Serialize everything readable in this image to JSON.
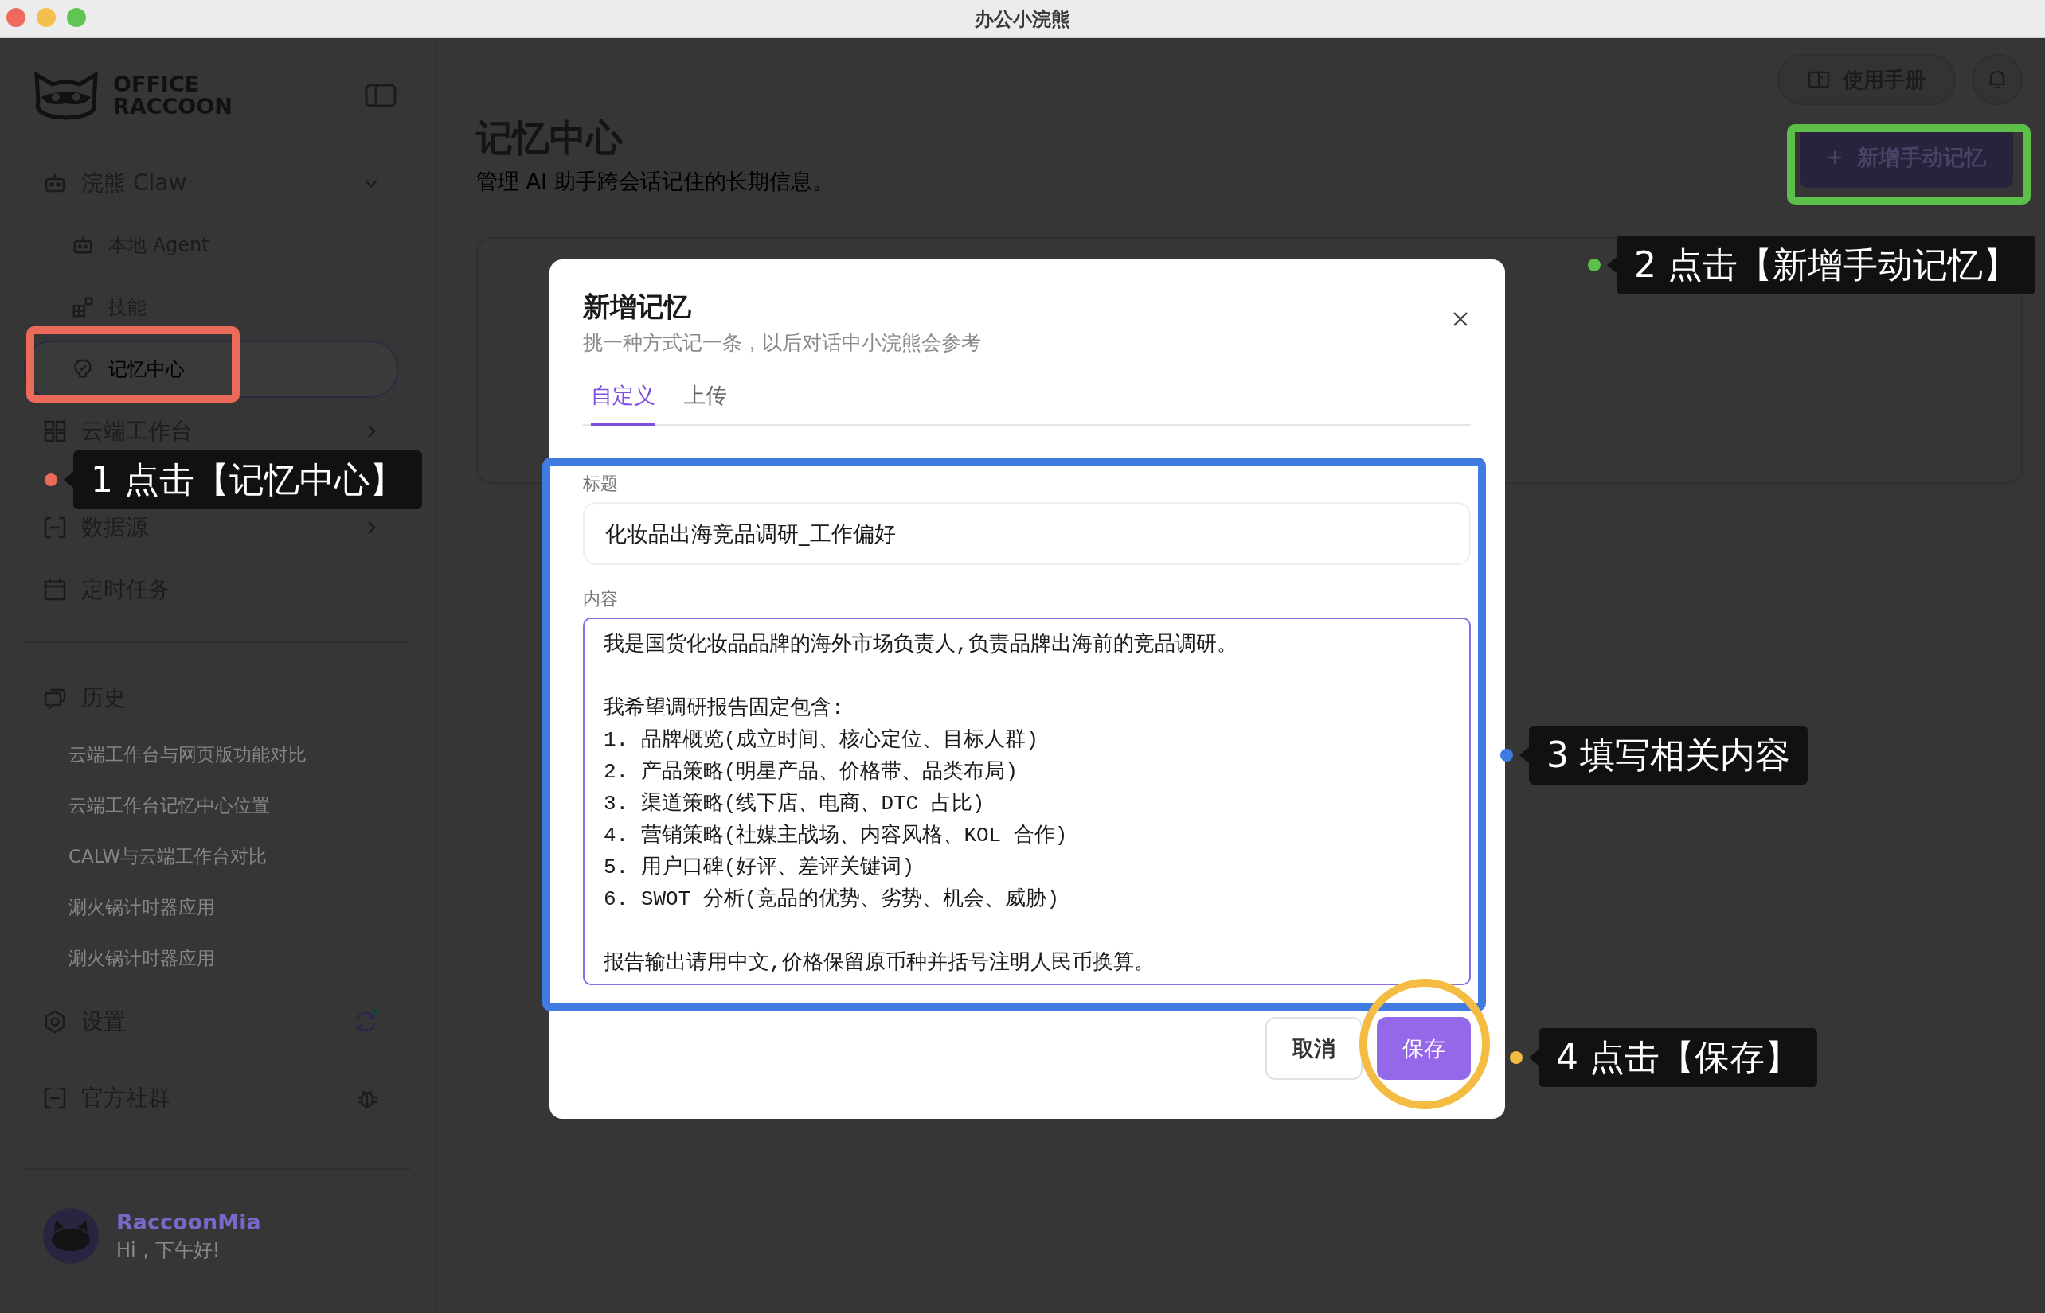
{
  "window": {
    "title": "办公小浣熊"
  },
  "sidebar": {
    "logo": {
      "line_1": "OFFICE",
      "line_2": "RACCOON"
    },
    "nav": [
      {
        "label": "浣熊 Claw",
        "kind": "group",
        "expanded": true,
        "selected": false,
        "children": [
          {
            "label": "本地 Agent",
            "selected": false
          },
          {
            "label": "技能",
            "selected": false
          },
          {
            "label": "记忆中心",
            "selected": true
          }
        ]
      },
      {
        "label": "云端工作台",
        "kind": "group",
        "expanded": false,
        "selected": false
      },
      {
        "label": "数据源",
        "kind": "group",
        "expanded": false,
        "selected": false
      },
      {
        "label": "定时任务",
        "kind": "link",
        "selected": false
      }
    ],
    "history": {
      "title": "历史",
      "items": [
        "云端工作台与网页版功能对比",
        "云端工作台记忆中心位置",
        "CALW与云端工作台对比",
        "涮火锅计时器应用",
        "涮火锅计时器应用"
      ]
    },
    "footer_items": [
      {
        "label": "设置"
      },
      {
        "label": "官方社群"
      }
    ],
    "user": {
      "name": "RaccoonMia",
      "greeting": "Hi，下午好!"
    }
  },
  "main": {
    "title": "记忆中心",
    "subtitle": "管理 AI 助手跨会话记住的长期信息。",
    "manual_button": "使用手册",
    "new_button": "新增手动记忆"
  },
  "dialog": {
    "title": "新增记忆",
    "subtitle": "挑一种方式记一条，以后对话中小浣熊会参考",
    "tabs": [
      {
        "label": "自定义",
        "selected": true
      },
      {
        "label": "上传",
        "selected": false
      }
    ],
    "fields": [
      {
        "label": "标题",
        "kind": "input",
        "focused": false,
        "value": "化妆品出海竞品调研_工作偏好"
      },
      {
        "label": "内容",
        "kind": "textarea",
        "focused": true,
        "paragraphs": [
          [
            "我是国货化妆品品牌的海外市场负责人,负责品牌出海前的竞品调研。"
          ],
          [
            "我希望调研报告固定包含:",
            "1. 品牌概览(成立时间、核心定位、目标人群)",
            "2. 产品策略(明星产品、价格带、品类布局)",
            "3. 渠道策略(线下店、电商、DTC 占比)",
            "4. 营销策略(社媒主战场、内容风格、KOL 合作)",
            "5. 用户口碑(好评、差评关键词)",
            "6. SWOT 分析(竞品的优势、劣势、机会、威胁)"
          ],
          [
            "报告输出请用中文,价格保留原币种并括号注明人民币换算。"
          ]
        ]
      }
    ],
    "buttons": [
      {
        "label": "取消",
        "kind": "secondary"
      },
      {
        "label": "保存",
        "kind": "primary"
      }
    ]
  },
  "annotations": [
    {
      "label": "1 点击【记忆中心】",
      "color": "#ec6a5a"
    },
    {
      "label": "2 点击【新增手动记忆】",
      "color": "#5cbf4a"
    },
    {
      "label": "3 填写相关内容",
      "color": "#3f7be0"
    },
    {
      "label": "4 点击【保存】",
      "color": "#f4bc42"
    }
  ]
}
